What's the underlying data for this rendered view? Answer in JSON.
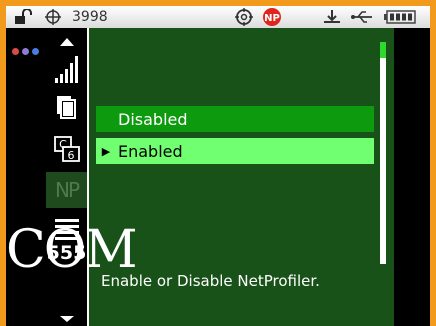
{
  "statusbar": {
    "counter": "3998",
    "icons": [
      "unlock-icon",
      "crosshair-icon",
      "target-icon",
      "netprofiler-icon",
      "usb-icon",
      "battery-icon"
    ]
  },
  "sidebar": {
    "dot_colors": [
      "#d94b4b",
      "#8b7cd6",
      "#4a7be0"
    ]
  },
  "toolstrip": {
    "items": [
      "scroll-up-arrow",
      "signal-bars-icon",
      "copy-icon",
      "cable-icon",
      "netprofiler-tab",
      "list-icon",
      "scroll-down-arrow"
    ],
    "selected": "netprofiler-tab",
    "cable_label_top": "C",
    "cable_label_bottom": "6",
    "np_label": "NP",
    "list_number": "555"
  },
  "menu": {
    "items": [
      {
        "label": "Disabled",
        "selected": false
      },
      {
        "label": "Enabled",
        "selected": true
      }
    ],
    "description": "Enable or Disable NetProfiler.",
    "colors": {
      "background": "#185218",
      "selected": "#70ff70",
      "item": "#0e9a0e"
    }
  },
  "watermark": "COM"
}
